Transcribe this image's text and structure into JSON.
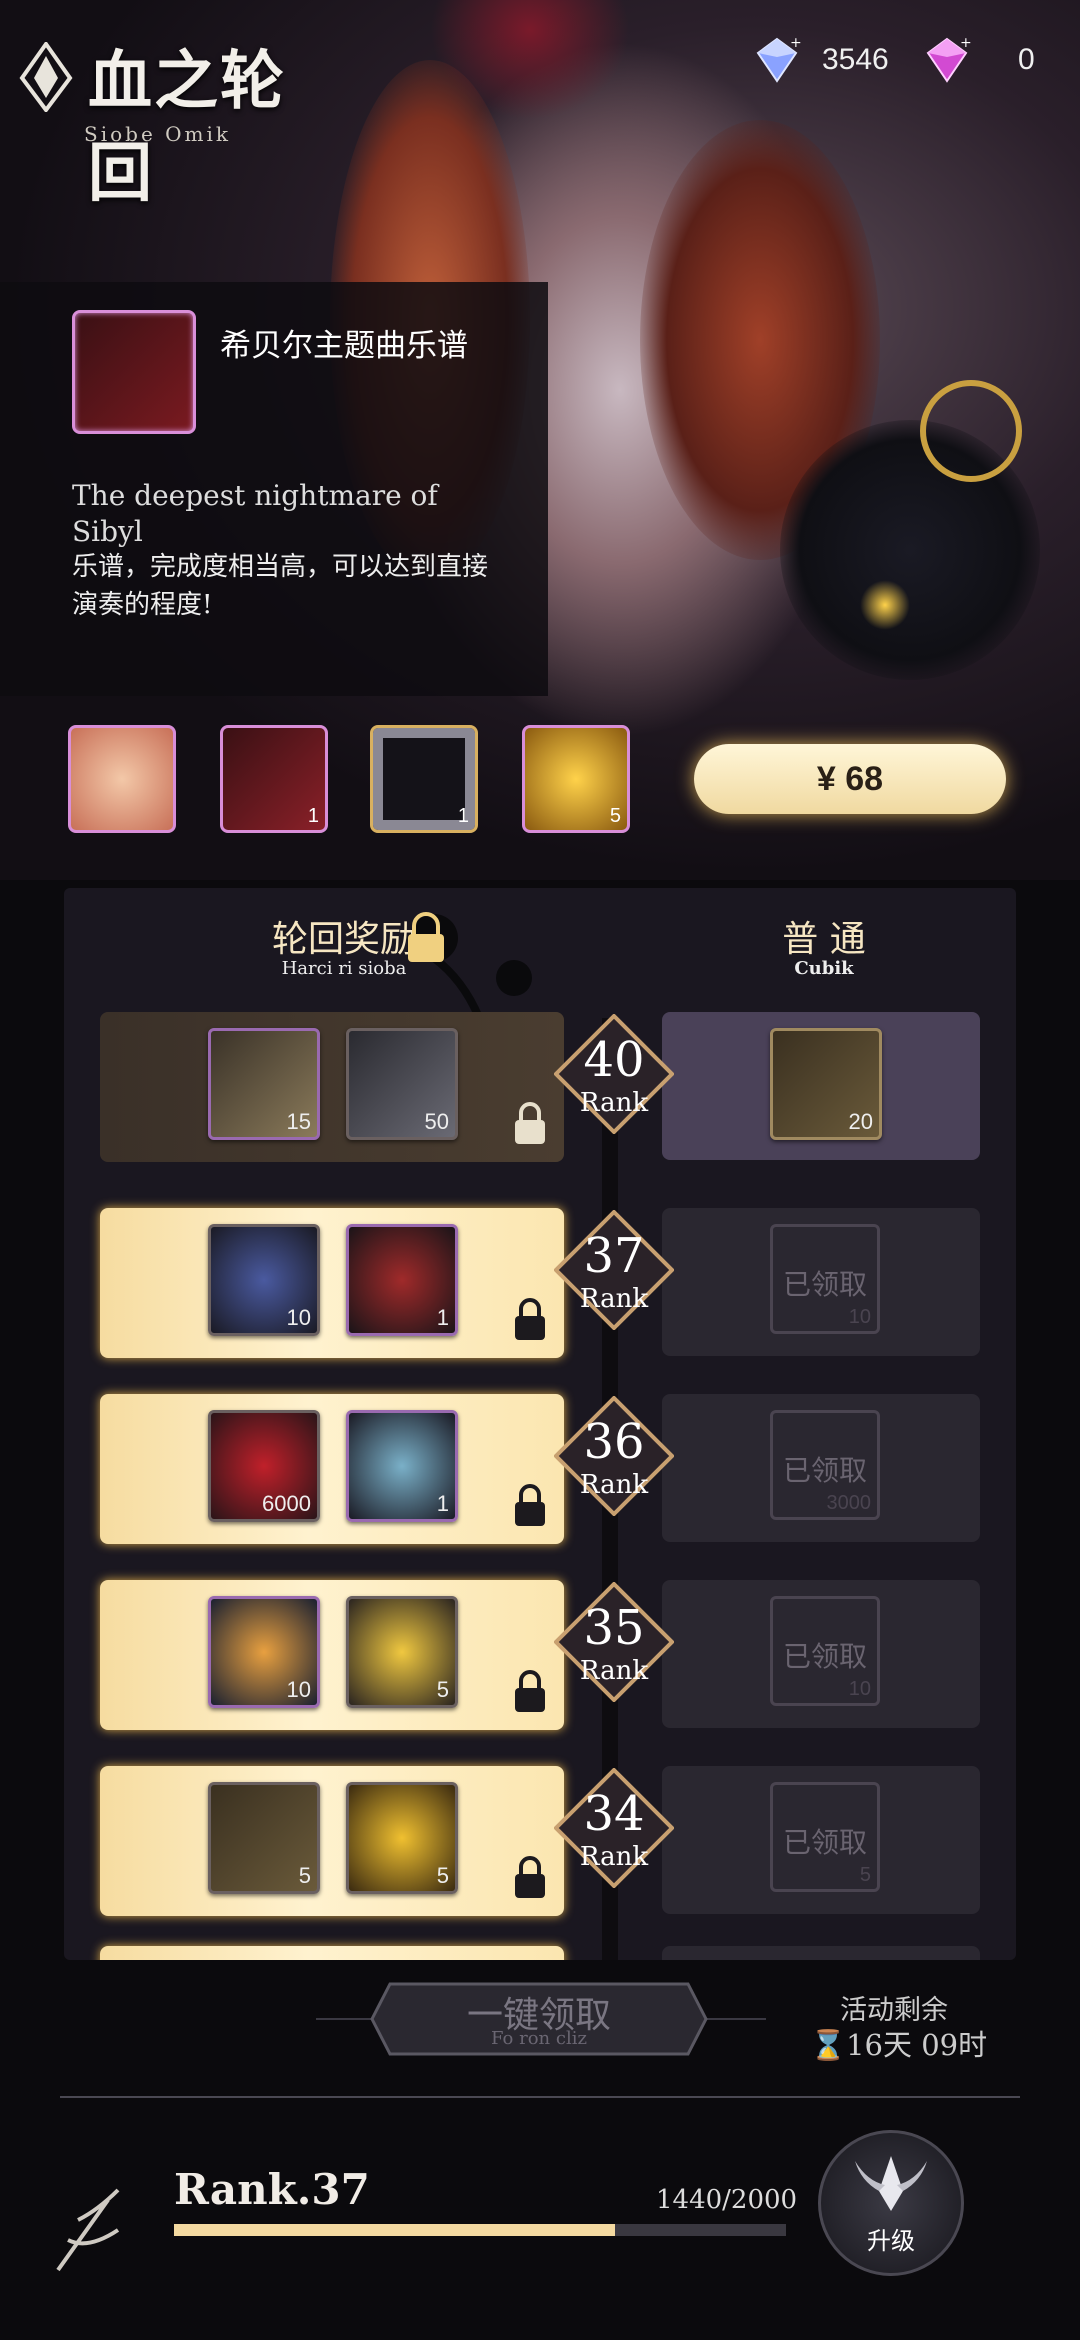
{
  "header": {
    "title": "血之轮回",
    "subtitle": "Siobe Omik",
    "currencies": [
      {
        "icon": "blue-diamond-icon",
        "value": "3546"
      },
      {
        "icon": "pink-diamond-icon",
        "value": "0"
      }
    ]
  },
  "info_panel": {
    "item_name": "希贝尔主题曲乐谱",
    "desc_en": "The deepest nightmare of Sibyl",
    "desc_cn": "乐谱，完成度相当高，可以达到直接演奏的程度!"
  },
  "reward_preview": [
    {
      "icon": "character-portrait-icon",
      "count": ""
    },
    {
      "icon": "music-book-icon",
      "count": "1"
    },
    {
      "icon": "silver-frame-icon",
      "count": "1"
    },
    {
      "icon": "gold-card-icon",
      "count": "5"
    }
  ],
  "price_button": {
    "label": "¥ 68"
  },
  "panel": {
    "left_title": "轮回奖励",
    "left_sub": "Harci ri sioba",
    "right_title": "普 通",
    "right_sub": "Cubik",
    "rank_label": "Rank",
    "claimed_text": "已领取"
  },
  "rows": [
    {
      "rank": "40",
      "left": [
        {
          "icon": "ticket-icon",
          "count": "15"
        },
        {
          "icon": "silver-chest-icon",
          "count": "50"
        }
      ],
      "right": {
        "icon": "bronze-chest-icon",
        "count": "20",
        "claimed": false
      }
    },
    {
      "rank": "37",
      "left": [
        {
          "icon": "spiked-orb-icon",
          "count": "10"
        },
        {
          "icon": "clock-rune-icon",
          "count": "1"
        }
      ],
      "right": {
        "icon": "orb-icon",
        "count": "10",
        "claimed": true
      }
    },
    {
      "rank": "36",
      "left": [
        {
          "icon": "red-gem-icon",
          "count": "6000"
        },
        {
          "icon": "blue-crystal-icon",
          "count": "1"
        }
      ],
      "right": {
        "icon": "red-gem-icon",
        "count": "3000",
        "claimed": true
      }
    },
    {
      "rank": "35",
      "left": [
        {
          "icon": "glowing-orb-icon",
          "count": "10"
        },
        {
          "icon": "gold-crown-icon",
          "count": "5"
        }
      ],
      "right": {
        "icon": "orb-icon",
        "count": "10",
        "claimed": true
      }
    },
    {
      "rank": "34",
      "left": [
        {
          "icon": "bronze-chest-icon",
          "count": "5"
        },
        {
          "icon": "gold-cube-icon",
          "count": "5"
        }
      ],
      "right": {
        "icon": "chest-icon",
        "count": "5",
        "claimed": true
      }
    }
  ],
  "footer": {
    "claim_all": "一键领取",
    "claim_all_sub": "Fo ron cliz",
    "remaining_label": "活动剩余",
    "remaining_value": "16天 09时",
    "rank_text": "Rank.37",
    "exp_current": "1440",
    "exp_total": "2000",
    "exp_display": "1440/2000",
    "exp_fraction": 0.72,
    "upgrade_label": "升级"
  }
}
